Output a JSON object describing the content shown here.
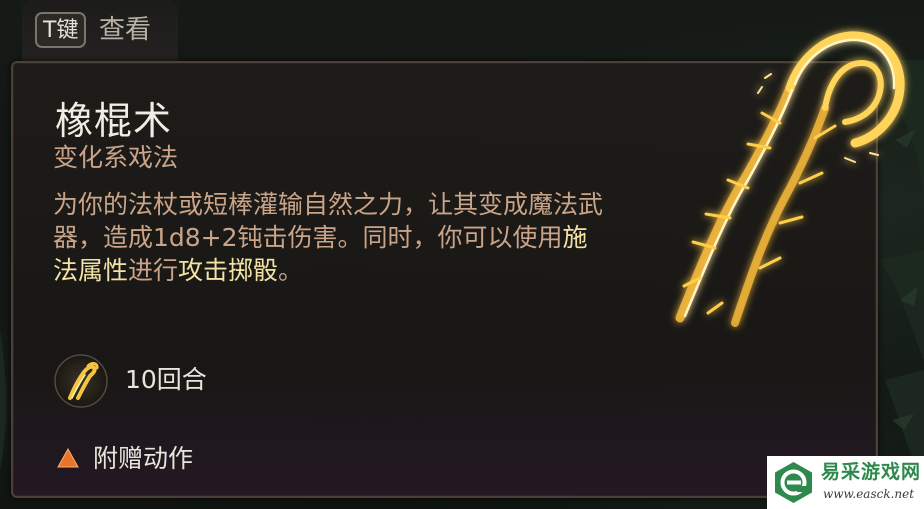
{
  "hint": {
    "key": "T键",
    "label": "查看"
  },
  "spell": {
    "name": "橡棍术",
    "school": "变化系戏法",
    "description": [
      {
        "text": "为你的法杖或短棒灌输自然之力，让其变成魔法武器，造成1d8+2钝击伤害。同时，你可以使用",
        "highlight": false
      },
      {
        "text": "施法属性",
        "highlight": true
      },
      {
        "text": "进行",
        "highlight": false
      },
      {
        "text": "攻击掷骰",
        "highlight": true
      },
      {
        "text": "。",
        "highlight": false
      }
    ],
    "duration": "10回合",
    "action_type": "附赠动作"
  },
  "icons": {
    "spell_art": "glowing-shillelagh-club-icon",
    "duration": "shillelagh-spell-icon",
    "action": "bonus-action-triangle-icon"
  },
  "watermark": {
    "name": "易采游戏网",
    "url": "www.easck.net"
  },
  "colors": {
    "card_bg": "#1e1c19",
    "title": "#f1ede4",
    "subtitle": "#c9a489",
    "highlight": "#f2e2a4",
    "glow": "#ffd45a",
    "action_icon": "#e8742a",
    "watermark_green": "#2e8a4c"
  }
}
